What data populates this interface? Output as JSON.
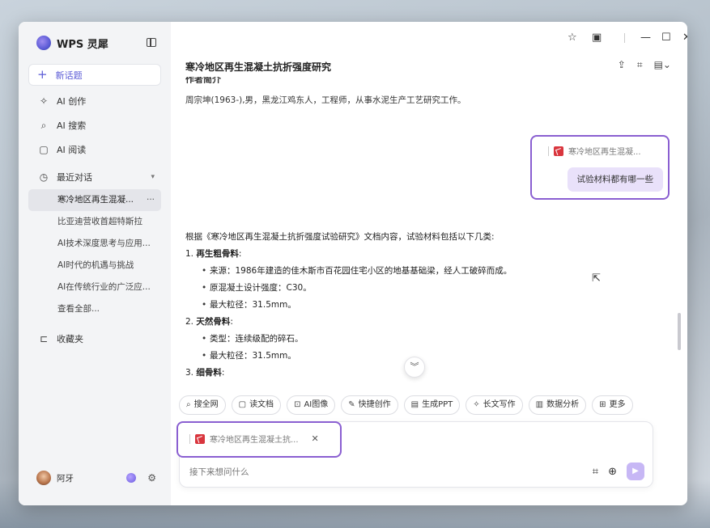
{
  "app": {
    "name": "WPS 灵犀"
  },
  "sidebar": {
    "new_chat": "新话题",
    "nav": [
      {
        "label": "AI 创作",
        "icon": "sparkle-icon"
      },
      {
        "label": "AI 搜索",
        "icon": "search-icon"
      },
      {
        "label": "AI 阅读",
        "icon": "read-icon"
      }
    ],
    "recent_label": "最近对话",
    "recent": [
      "寒冷地区再生混凝...",
      "比亚迪营收首超特斯拉",
      "AI技术深度思考与应用...",
      "AI时代的机遇与挑战",
      "AI在传统行业的广泛应...",
      "查看全部..."
    ],
    "favorites": "收藏夹",
    "user": "阿牙"
  },
  "main": {
    "doc_title": "寒冷地区再生混凝土抗折强度研究",
    "cut_heading": "作者简介",
    "author_line": "周宗坤(1963-),男，黑龙江鸡东人，工程师，从事水泥生产工艺研究工作。",
    "user_message": {
      "file": "寒冷地区再生混凝...",
      "question": "试验材料都有哪一些"
    },
    "answer": {
      "lead": "根据《寒冷地区再生混凝土抗折强度试验研究》文档内容，试验材料包括以下几类:",
      "items": [
        {
          "num": "1.",
          "title": "再生粗骨料",
          "bullets": [
            "来源：1986年建造的佳木斯市百花园住宅小区的地基基础梁，经人工破碎而成。",
            "原混凝土设计强度：C30。",
            "最大粒径：31.5mm。"
          ]
        },
        {
          "num": "2.",
          "title": "天然骨料",
          "bullets": [
            "类型：连续级配的碎石。",
            "最大粒径：31.5mm。"
          ]
        },
        {
          "num": "3.",
          "title": "细骨料",
          "bullets": []
        }
      ]
    },
    "tools": [
      {
        "label": "搜全网",
        "icon": "search-icon"
      },
      {
        "label": "读文档",
        "icon": "book-icon"
      },
      {
        "label": "AI图像",
        "icon": "image-icon"
      },
      {
        "label": "快捷创作",
        "icon": "pen-icon"
      },
      {
        "label": "生成PPT",
        "icon": "ppt-icon"
      },
      {
        "label": "长文写作",
        "icon": "sparkle-icon"
      },
      {
        "label": "数据分析",
        "icon": "chart-icon"
      },
      {
        "label": "更多",
        "icon": "grid-icon"
      }
    ],
    "composer": {
      "attachment": "寒冷地区再生混凝土抗...",
      "placeholder": "接下来想问什么"
    }
  }
}
